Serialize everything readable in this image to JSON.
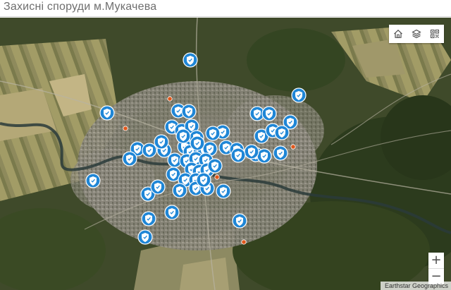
{
  "header": {
    "title": "Захисні споруди м.Мукачева"
  },
  "toolbar": {
    "items": [
      {
        "name": "home-button",
        "icon": "home-icon"
      },
      {
        "name": "basemap-button",
        "icon": "layers-icon"
      },
      {
        "name": "qr-button",
        "icon": "qr-code-icon"
      }
    ]
  },
  "zoom": {
    "in_label": "+",
    "out_label": "−"
  },
  "attribution": {
    "text": "Earthstar Geographics"
  },
  "map": {
    "basemap": "satellite imagery",
    "shelter_marker_color": "#1f86d6",
    "shelter_marker_icon": "shield-check-icon",
    "poi_dot_color": "#e0581c",
    "shelter_count": 58,
    "poi_count": 10
  }
}
